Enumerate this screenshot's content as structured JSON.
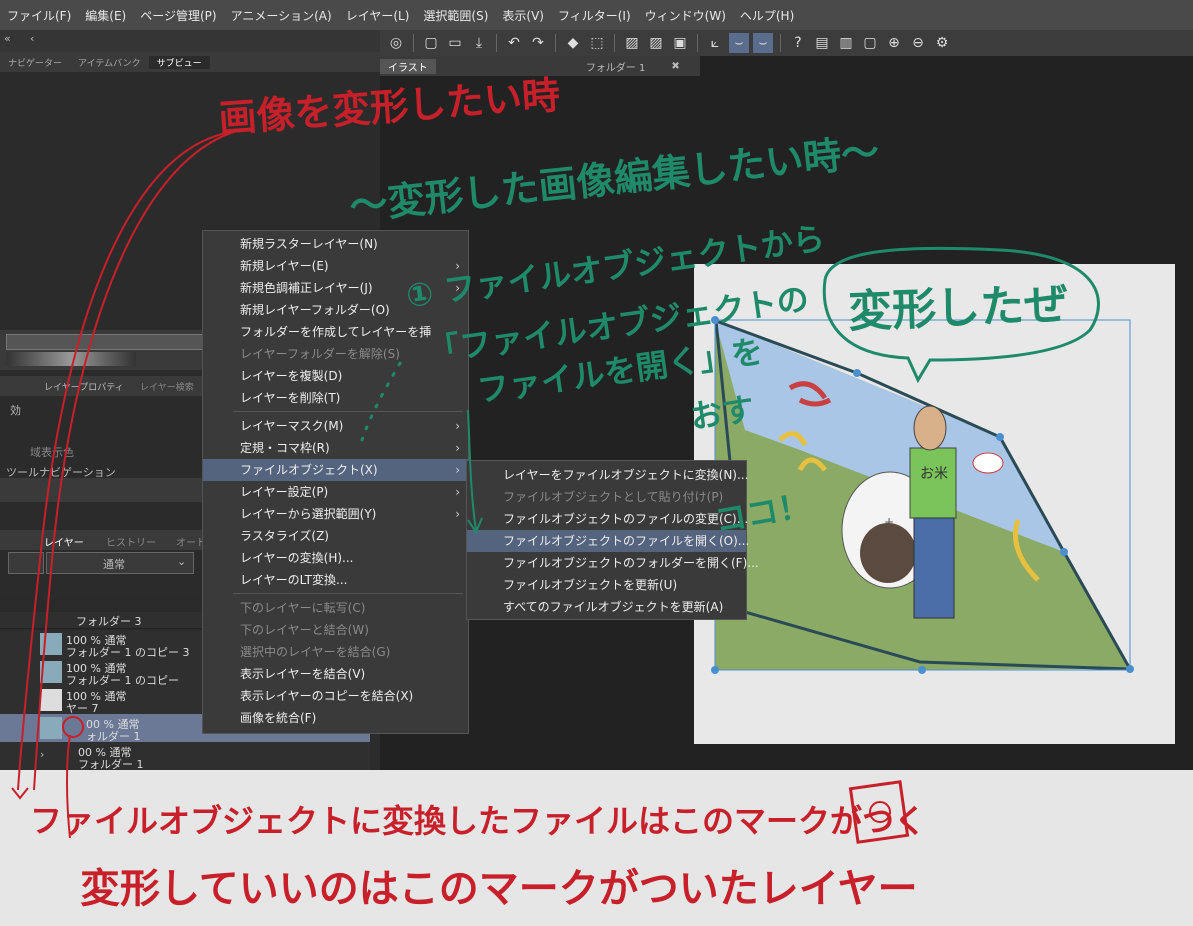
{
  "menubar": [
    "ファイル(F)",
    "編集(E)",
    "ページ管理(P)",
    "アニメーション(A)",
    "レイヤー(L)",
    "選択範囲(S)",
    "表示(V)",
    "フィルター(I)",
    "ウィンドウ(W)",
    "ヘルプ(H)"
  ],
  "left_tabs": [
    "ナビゲーター",
    "アイテムバンク",
    "サブビュー"
  ],
  "doc_tabs": [
    "イラスト",
    "フォルダー 1"
  ],
  "layer_property": {
    "tabs": [
      "レイヤープロパティ",
      "レイヤー検索"
    ],
    "effect": "効",
    "region_color": "域表示色",
    "tool_nav": "ツールナビゲーション"
  },
  "layer_panel": {
    "tabs": [
      "レイヤー",
      "ヒストリー",
      "オート"
    ],
    "blend_mode": "通常",
    "rows": [
      {
        "line1": "フォルダー 3",
        "line2": ""
      },
      {
        "line1": "100 % 通常",
        "line2": "フォルダー 1 のコピー 3"
      },
      {
        "line1": "100 % 通常",
        "line2": "フォルダー 1 のコピー"
      },
      {
        "line1": "100 % 通常",
        "line2": "ヤー 7"
      },
      {
        "line1": "00 % 通常",
        "line2": "ォルダー 1"
      },
      {
        "line1": "00 % 通常",
        "line2": "フォルダー 1"
      }
    ]
  },
  "context_menu": [
    {
      "label": "新規ラスターレイヤー(N)",
      "state": "normal"
    },
    {
      "label": "新規レイヤー(E)",
      "state": "normal",
      "arrow": true
    },
    {
      "label": "新規色調補正レイヤー(J)",
      "state": "normal",
      "arrow": true
    },
    {
      "label": "新規レイヤーフォルダー(O)",
      "state": "normal"
    },
    {
      "label": "フォルダーを作成してレイヤーを挿",
      "state": "normal"
    },
    {
      "label": "レイヤーフォルダーを解除(S)",
      "state": "disabled"
    },
    {
      "label": "レイヤーを複製(D)",
      "state": "normal"
    },
    {
      "label": "レイヤーを削除(T)",
      "state": "normal"
    },
    {
      "label": "レイヤーマスク(M)",
      "state": "normal",
      "arrow": true,
      "sep_before": true
    },
    {
      "label": "定規・コマ枠(R)",
      "state": "normal",
      "arrow": true
    },
    {
      "label": "ファイルオブジェクト(X)",
      "state": "highlight",
      "arrow": true
    },
    {
      "label": "レイヤー設定(P)",
      "state": "normal",
      "arrow": true
    },
    {
      "label": "レイヤーから選択範囲(Y)",
      "state": "normal",
      "arrow": true
    },
    {
      "label": "ラスタライズ(Z)",
      "state": "normal"
    },
    {
      "label": "レイヤーの変換(H)...",
      "state": "normal"
    },
    {
      "label": "レイヤーのLT変換...",
      "state": "normal"
    },
    {
      "label": "下のレイヤーに転写(C)",
      "state": "disabled",
      "sep_before": true
    },
    {
      "label": "下のレイヤーと結合(W)",
      "state": "disabled"
    },
    {
      "label": "選択中のレイヤーを結合(G)",
      "state": "disabled"
    },
    {
      "label": "表示レイヤーを結合(V)",
      "state": "normal"
    },
    {
      "label": "表示レイヤーのコピーを結合(X)",
      "state": "normal"
    },
    {
      "label": "画像を統合(F)",
      "state": "normal"
    }
  ],
  "submenu": [
    {
      "label": "レイヤーをファイルオブジェクトに変換(N)...",
      "state": "normal"
    },
    {
      "label": "ファイルオブジェクトとして貼り付け(P)",
      "state": "disabled"
    },
    {
      "label": "ファイルオブジェクトのファイルの変更(C)...",
      "state": "normal"
    },
    {
      "label": "ファイルオブジェクトのファイルを開く(O)...",
      "state": "highlight"
    },
    {
      "label": "ファイルオブジェクトのフォルダーを開く(F)...",
      "state": "normal"
    },
    {
      "label": "ファイルオブジェクトを更新(U)",
      "state": "normal"
    },
    {
      "label": "すべてのファイルオブジェクトを更新(A)",
      "state": "normal"
    }
  ],
  "annotations": {
    "red_title": "画像を変形したい時",
    "green_title": "～変形した画像編集したい時～",
    "green_step1": "① ファイルオブジェクトから",
    "green_step2": "「ファイルオブジェクトの",
    "green_step3": "ファイルを開く」を",
    "green_step4": "おす",
    "green_here": "ココ！",
    "speech": "変形したぜ",
    "shirt": "お米",
    "red_note1": "ファイルオブジェクトに変換したファイルはこのマークがつく",
    "red_note2": "変形していいのはこのマークがついたレイヤー"
  },
  "colors": {
    "annotation_red": "#c8202a",
    "annotation_green": "#1f8a6a",
    "menu_highlight": "#55647e"
  }
}
